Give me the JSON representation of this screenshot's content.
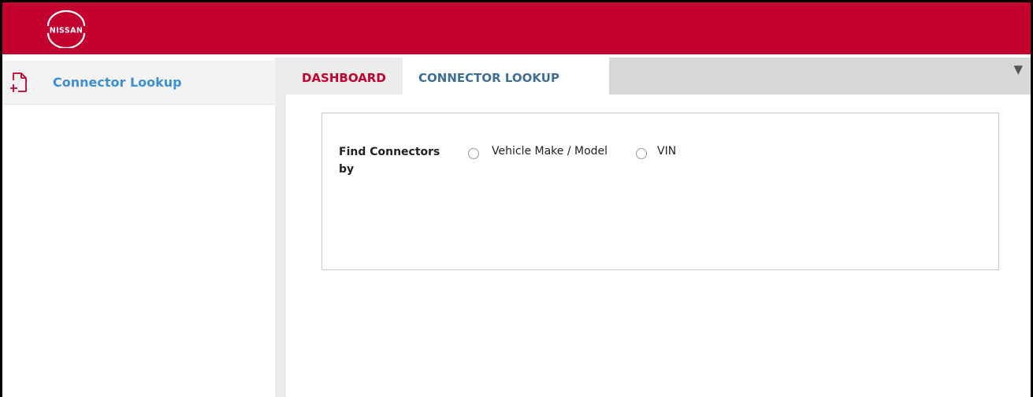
{
  "header": {
    "logo_text": "NISSAN",
    "background": "#c4002f"
  },
  "sidebar": {
    "items": [
      {
        "label": "Connector Lookup",
        "icon": "document-add-icon",
        "active": true
      }
    ]
  },
  "tabs": [
    {
      "label": "DASHBOARD",
      "active": false
    },
    {
      "label": "CONNECTOR LOOKUP",
      "active": true
    }
  ],
  "tab_menu_icon": "triangle-down-icon",
  "form": {
    "find_label": "Find Connectors by",
    "options": [
      {
        "label": "Vehicle Make / Model",
        "selected": false
      },
      {
        "label": "VIN",
        "selected": false
      }
    ]
  },
  "colors": {
    "brand_red": "#c4002f",
    "link_blue": "#3d8fd6",
    "tab_active_text": "#3e6f96"
  }
}
